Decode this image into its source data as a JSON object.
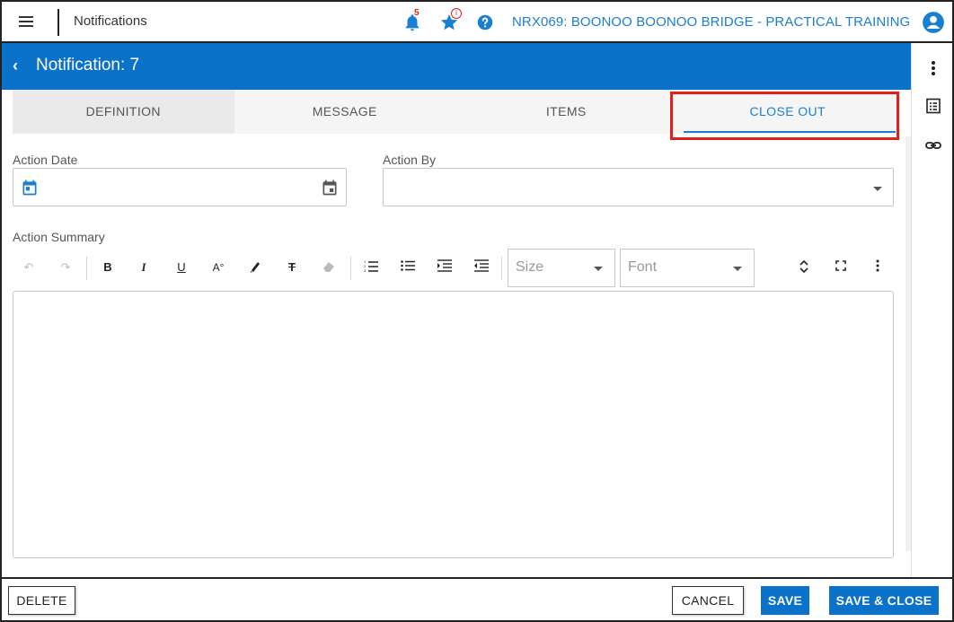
{
  "topbar": {
    "title": "Notifications",
    "notification_count": "5",
    "favorites_badge": "i",
    "project": "NRX069: BOONOO BOONOO BRIDGE - PRACTICAL TRAINING"
  },
  "header": {
    "title": "Notification: 7"
  },
  "tabs": [
    {
      "label": "DEFINITION"
    },
    {
      "label": "MESSAGE"
    },
    {
      "label": "ITEMS"
    },
    {
      "label": "CLOSE OUT"
    }
  ],
  "form": {
    "action_date_label": "Action Date",
    "action_date_value": "",
    "action_by_label": "Action By",
    "action_by_value": "",
    "action_summary_label": "Action Summary",
    "size_placeholder": "Size",
    "font_placeholder": "Font"
  },
  "footer": {
    "delete_label": "DELETE",
    "cancel_label": "CANCEL",
    "save_label": "SAVE",
    "save_close_label": "SAVE & CLOSE"
  },
  "colors": {
    "accent": "#0b72c9",
    "link": "#1a7fd0",
    "highlight": "#e0201b"
  }
}
